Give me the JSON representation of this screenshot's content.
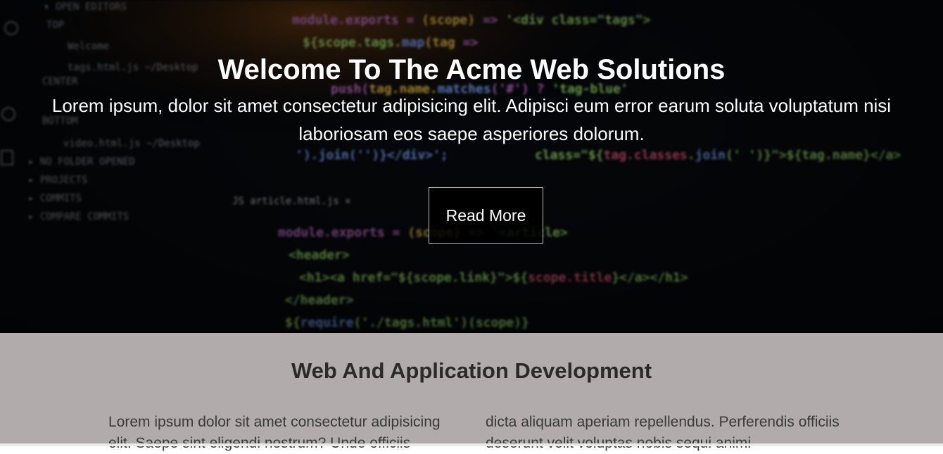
{
  "hero": {
    "title": "Welcome To The Acme Web Solutions",
    "text": "Lorem ipsum, dolor sit amet consectetur adipisicing elit. Adipisci eum error earum soluta voluptatum nisi laboriosam eos saepe asperiores dolorum.",
    "button_label": "Read More"
  },
  "section": {
    "title": "Web And Application Development",
    "col_left": "Lorem ipsum dolor sit amet consectetur adipisicing elit. Saepe sint eligendi nostrum? Unde officiis",
    "col_right": "dicta aliquam aperiam repellendus. Perferendis officiis deserunt velit voluptas nobis sequi animi"
  },
  "colors": {
    "section_bg": "#b1acab",
    "hero_bg": "#05070a",
    "text_light": "#ffffff"
  }
}
